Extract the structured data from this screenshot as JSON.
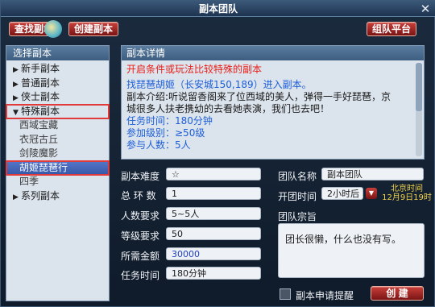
{
  "window": {
    "title": "副本团队",
    "close": "✕"
  },
  "toolbar": {
    "find_label": "查找副本",
    "create_label": "创建副本",
    "platform_label": "组队平台"
  },
  "sidebar": {
    "header": "选择副本",
    "items": [
      {
        "label": "新手副本",
        "arrow": "▶"
      },
      {
        "label": "普通副本",
        "arrow": "▶"
      },
      {
        "label": "侠士副本",
        "arrow": "▶"
      },
      {
        "label": "特殊副本",
        "arrow": "▼"
      },
      {
        "label": "西域宝藏"
      },
      {
        "label": "衣冠古丘"
      },
      {
        "label": "剑陵魔影"
      },
      {
        "label": "胡姬琵琶行"
      },
      {
        "label": "四季"
      },
      {
        "label": "系列副本",
        "arrow": "▶"
      }
    ]
  },
  "detail": {
    "header": "副本详情",
    "condition": "开启条件或玩法比较特殊的副本",
    "find_npc": "找琵琶胡姬（长安城150,189）进入副本。",
    "intro_1": "副本介绍:听说留香阁来了位西域的美人，弹得一手好琵琶，京",
    "intro_2": "城很多人扶老携幼的去看她表演，我们也去吧！",
    "task_time": "任务时间：180分钟",
    "level": "参加级别：≥50级",
    "participants": "参与人数：5人"
  },
  "form": {
    "difficulty_label": "副本难度",
    "difficulty_value": "☆",
    "rounds_label": "总 环 数",
    "rounds_value": "1",
    "people_label": "人数要求",
    "people_value": "5~5人",
    "level_label": "等级要求",
    "level_value": "50",
    "money_label": "所需金额",
    "money_value": "30000",
    "time_label": "任务时间",
    "time_value": "180分钟",
    "team_name_label": "团队名称",
    "team_name_value": "副本团队",
    "start_label": "开团时间",
    "start_value": "2小时后",
    "start_arrow": "▼",
    "beijing_time": "北京时间",
    "beijing_date": "12月9日19时",
    "purpose_label": "团队宗旨",
    "purpose_value": "团长很懒，什么也没有写。",
    "remind_label": "副本申请提醒",
    "create_btn": "创 建"
  },
  "colors": {
    "accent_red": "#c93f3a",
    "highlight": "#e13a3a",
    "select_blue": "#3657a8"
  }
}
